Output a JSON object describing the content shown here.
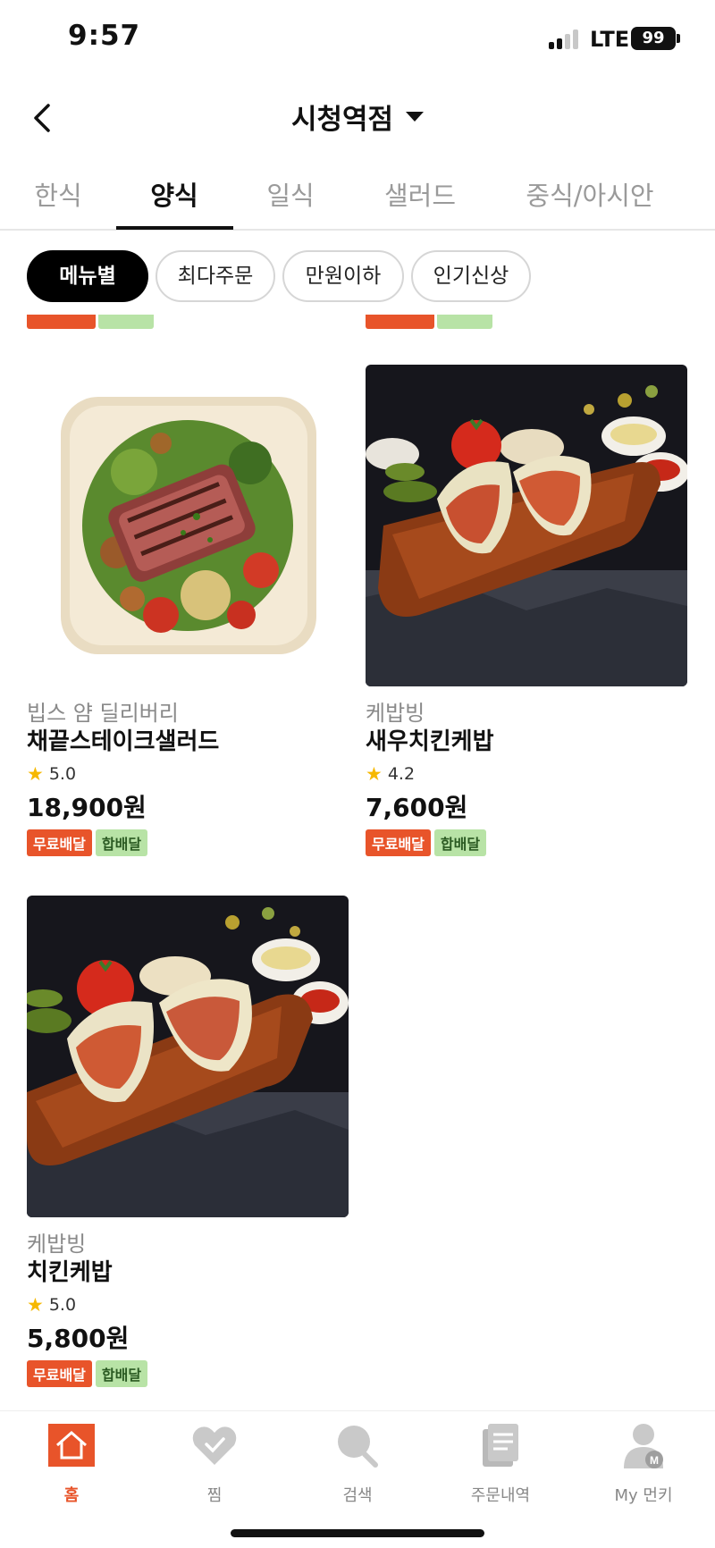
{
  "status_bar": {
    "time": "9:57",
    "network": "LTE",
    "battery": "99"
  },
  "header": {
    "title": "시청역점"
  },
  "tabs": [
    {
      "label": "한식",
      "active": false
    },
    {
      "label": "양식",
      "active": true
    },
    {
      "label": "일식",
      "active": false
    },
    {
      "label": "샐러드",
      "active": false
    },
    {
      "label": "중식/아시안",
      "active": false
    }
  ],
  "filters": [
    {
      "label": "메뉴별",
      "active": true
    },
    {
      "label": "최다주문",
      "active": false
    },
    {
      "label": "만원이하",
      "active": false
    },
    {
      "label": "인기신상",
      "active": false
    }
  ],
  "products": [
    {
      "store": "빕스 얌 딜리버리",
      "name": "채끝스테이크샐러드",
      "rating": "5.0",
      "price": "18,900원",
      "badges": [
        "무료배달",
        "합배달"
      ],
      "image": "steak-salad-image"
    },
    {
      "store": "케밥빙",
      "name": "새우치킨케밥",
      "rating": "4.2",
      "price": "7,600원",
      "badges": [
        "무료배달",
        "합배달"
      ],
      "image": "shrimp-chicken-kebab-image"
    },
    {
      "store": "케밥빙",
      "name": "치킨케밥",
      "rating": "5.0",
      "price": "5,800원",
      "badges": [
        "무료배달",
        "합배달"
      ],
      "image": "chicken-kebab-image"
    }
  ],
  "bottom_nav": [
    {
      "label": "홈",
      "icon": "home-icon",
      "active": true
    },
    {
      "label": "찜",
      "icon": "heart-icon",
      "active": false
    },
    {
      "label": "검색",
      "icon": "search-icon",
      "active": false
    },
    {
      "label": "주문내역",
      "icon": "order-history-icon",
      "active": false
    },
    {
      "label": "My 먼키",
      "icon": "profile-icon",
      "active": false
    }
  ],
  "colors": {
    "accent": "#e8542a",
    "combine_badge": "#b8e3a6",
    "star": "#f6b800"
  }
}
